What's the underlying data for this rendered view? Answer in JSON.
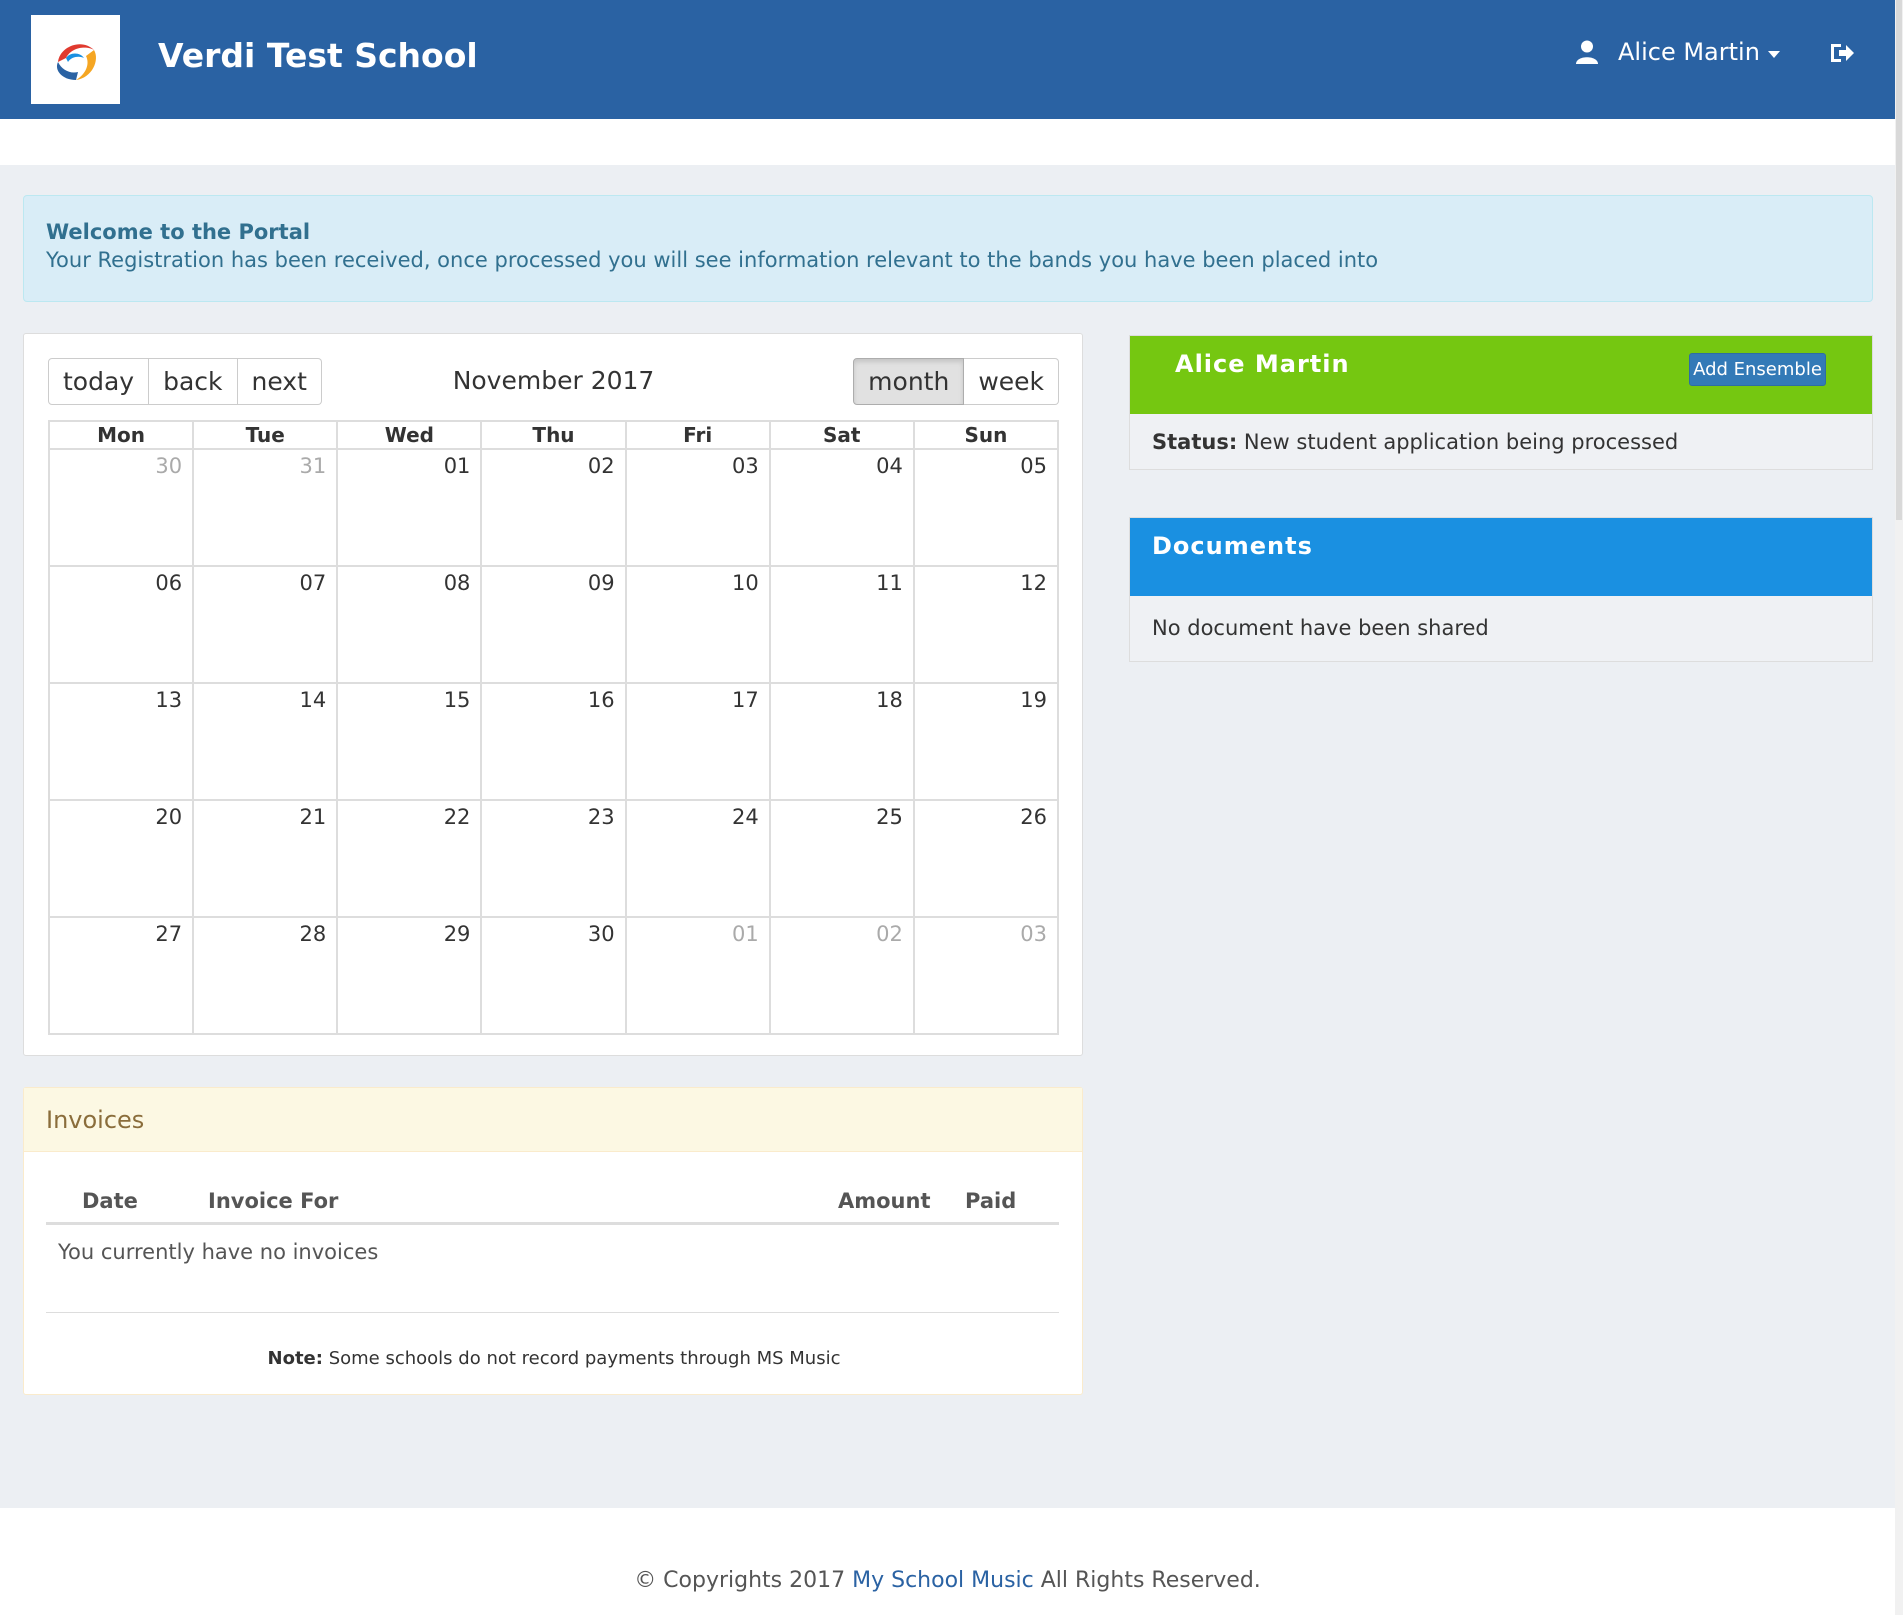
{
  "header": {
    "school_name": "Verdi Test School",
    "user_name": "Alice Martin",
    "brand_color": "#2a62a3"
  },
  "alert": {
    "title": "Welcome to the Portal",
    "text": "Your Registration has been received, once processed you will see information relevant to the bands you have been placed into"
  },
  "calendar": {
    "title": "November 2017",
    "nav": {
      "today": "today",
      "back": "back",
      "next": "next"
    },
    "views": {
      "month": "month",
      "week": "week",
      "active": "month"
    },
    "days": [
      "Mon",
      "Tue",
      "Wed",
      "Thu",
      "Fri",
      "Sat",
      "Sun"
    ],
    "weeks": [
      [
        {
          "d": "30",
          "other": true
        },
        {
          "d": "31",
          "other": true
        },
        {
          "d": "01"
        },
        {
          "d": "02"
        },
        {
          "d": "03"
        },
        {
          "d": "04"
        },
        {
          "d": "05"
        }
      ],
      [
        {
          "d": "06"
        },
        {
          "d": "07"
        },
        {
          "d": "08"
        },
        {
          "d": "09"
        },
        {
          "d": "10"
        },
        {
          "d": "11"
        },
        {
          "d": "12"
        }
      ],
      [
        {
          "d": "13"
        },
        {
          "d": "14"
        },
        {
          "d": "15"
        },
        {
          "d": "16"
        },
        {
          "d": "17"
        },
        {
          "d": "18"
        },
        {
          "d": "19"
        }
      ],
      [
        {
          "d": "20"
        },
        {
          "d": "21"
        },
        {
          "d": "22"
        },
        {
          "d": "23"
        },
        {
          "d": "24"
        },
        {
          "d": "25"
        },
        {
          "d": "26"
        }
      ],
      [
        {
          "d": "27"
        },
        {
          "d": "28"
        },
        {
          "d": "29"
        },
        {
          "d": "30"
        },
        {
          "d": "01",
          "other": true
        },
        {
          "d": "02",
          "other": true
        },
        {
          "d": "03",
          "other": true
        }
      ]
    ]
  },
  "invoices": {
    "heading": "Invoices",
    "columns": {
      "date": "Date",
      "invoice_for": "Invoice For",
      "amount": "Amount",
      "paid": "Paid"
    },
    "empty_text": "You currently have no invoices",
    "note_label": "Note:",
    "note_text": "Some schools do not record payments through MS Music"
  },
  "student": {
    "name": "Alice Martin",
    "add_button": "Add Ensemble",
    "status_label": "Status:",
    "status_text": "New student application being processed",
    "head_color": "#75c711"
  },
  "documents": {
    "title": "Documents",
    "empty_text": "No document have been shared",
    "head_color": "#1a90e1"
  },
  "footer": {
    "prefix": "© Copyrights 2017",
    "link": "My School Music",
    "suffix": "All Rights Reserved."
  },
  "icons": {
    "logo": "school-logo",
    "user": "user-icon",
    "caret": "caret-down-icon",
    "logout": "logout-icon"
  }
}
